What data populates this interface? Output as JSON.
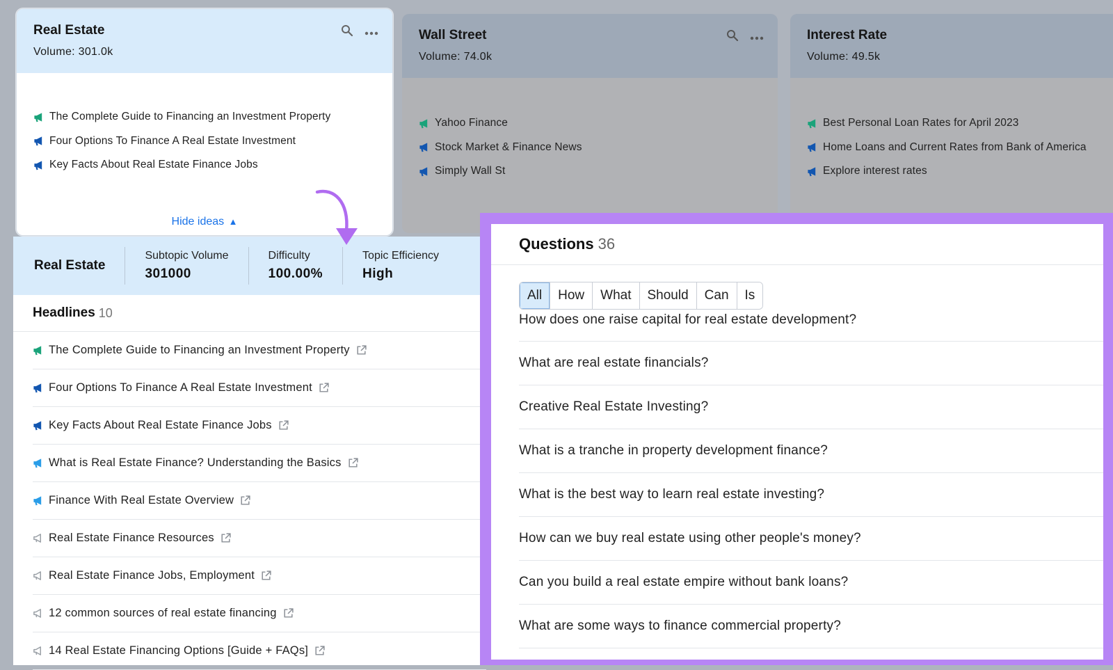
{
  "colors": {
    "purple_frame": "#b785f5",
    "accent_blue": "#1a73e8",
    "selected_bg": "#d8ebfb",
    "green_icon": "#1aa37a",
    "navy_icon": "#1256b0",
    "light_blue_icon": "#2a9de8",
    "gray_icon": "#9aa0a6"
  },
  "cards": [
    {
      "title": "Real Estate",
      "volume": "Volume: 301.0k",
      "ideas": [
        {
          "text": "The Complete Guide to Financing an Investment Property",
          "icon": "megaphone-icon-green"
        },
        {
          "text": "Four Options To Finance A Real Estate Investment",
          "icon": "megaphone-icon-navy"
        },
        {
          "text": "Key Facts About Real Estate Finance Jobs",
          "icon": "megaphone-icon-navy"
        }
      ],
      "toggle": "Hide ideas"
    },
    {
      "title": "Wall Street",
      "volume": "Volume: 74.0k",
      "ideas": [
        {
          "text": "Yahoo Finance",
          "icon": "megaphone-icon-green"
        },
        {
          "text": "Stock Market & Finance News",
          "icon": "megaphone-icon-navy"
        },
        {
          "text": "Simply Wall St",
          "icon": "megaphone-icon-navy"
        }
      ]
    },
    {
      "title": "Interest Rate",
      "volume": "Volume: 49.5k",
      "ideas": [
        {
          "text": "Best Personal Loan Rates for April 2023",
          "icon": "megaphone-icon-green"
        },
        {
          "text": "Home Loans and Current Rates from Bank of America",
          "icon": "megaphone-icon-navy"
        },
        {
          "text": "Explore interest rates",
          "icon": "megaphone-icon-navy"
        }
      ]
    }
  ],
  "summary": {
    "topic": "Real Estate",
    "subtopic_volume_label": "Subtopic Volume",
    "subtopic_volume": "301000",
    "difficulty_label": "Difficulty",
    "difficulty": "100.00%",
    "efficiency_label": "Topic Efficiency",
    "efficiency": "High"
  },
  "headlines": {
    "title": "Headlines",
    "count": "10",
    "items": [
      {
        "text": "The Complete Guide to Financing an Investment Property",
        "icon": "green"
      },
      {
        "text": "Four Options To Finance A Real Estate Investment",
        "icon": "navy"
      },
      {
        "text": "Key Facts About Real Estate Finance Jobs",
        "icon": "navy"
      },
      {
        "text": "What is Real Estate Finance? Understanding the Basics",
        "icon": "light"
      },
      {
        "text": "Finance With Real Estate Overview",
        "icon": "light"
      },
      {
        "text": "Real Estate Finance Resources",
        "icon": "gray"
      },
      {
        "text": "Real Estate Finance Jobs, Employment",
        "icon": "gray"
      },
      {
        "text": "12 common sources of real estate financing",
        "icon": "gray"
      },
      {
        "text": "14 Real Estate Financing Options [Guide + FAQs]",
        "icon": "gray"
      }
    ]
  },
  "questions": {
    "title": "Questions",
    "count": "36",
    "filters": [
      "All",
      "How",
      "What",
      "Should",
      "Can",
      "Is"
    ],
    "active_filter": "All",
    "items": [
      "How does one raise capital for real estate development?",
      "What are real estate financials?",
      "Creative Real Estate Investing?",
      "What is a tranche in property development finance?",
      "What is the best way to learn real estate investing?",
      "How can we buy real estate using other people's money?",
      "Can you build a real estate empire without bank loans?",
      "What are some ways to finance commercial property?"
    ]
  }
}
